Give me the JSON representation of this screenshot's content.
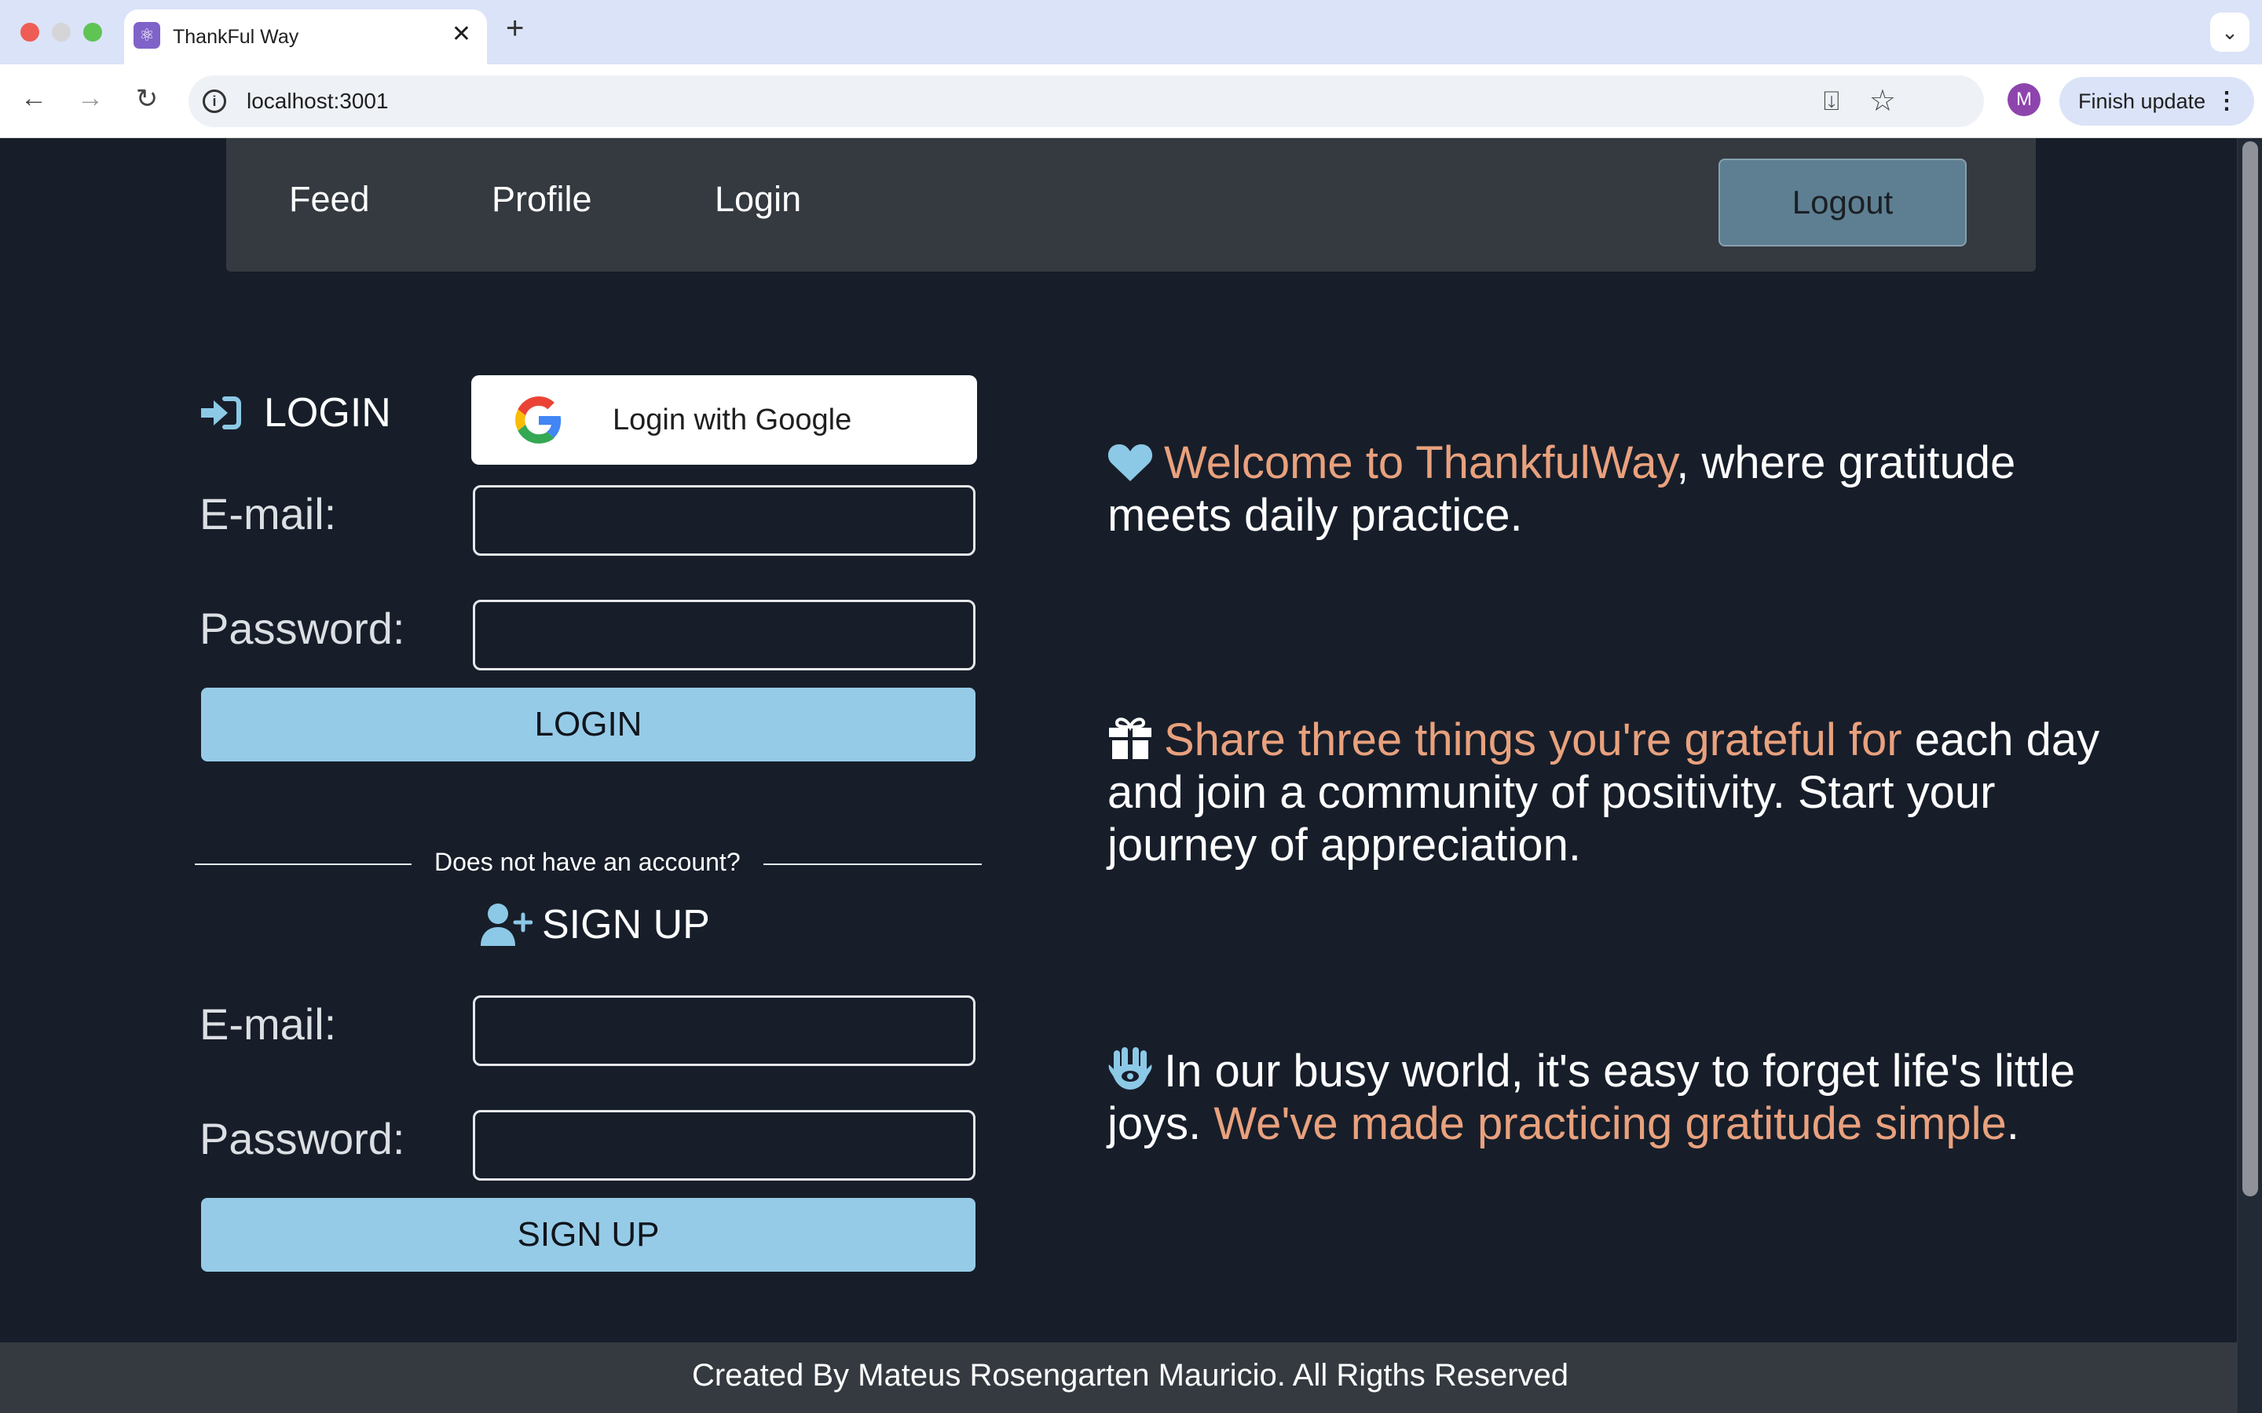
{
  "browser": {
    "tab_title": "ThankFul Way",
    "tab_close": "✕",
    "new_tab": "+",
    "tabs_menu": "⌄",
    "url": "localhost:3001",
    "avatar_letter": "M",
    "finish_update": "Finish update",
    "menu_dots": "⋮"
  },
  "navbar": {
    "feed": "Feed",
    "profile": "Profile",
    "login": "Login",
    "logout": "Logout"
  },
  "login": {
    "heading": "LOGIN",
    "google_button": "Login with Google",
    "email_label": "E-mail:",
    "email_value": "",
    "password_label": "Password:",
    "password_value": "",
    "submit": "LOGIN"
  },
  "divider_text": "Does not have an account?",
  "signup": {
    "heading": "SIGN UP",
    "email_label": "E-mail:",
    "email_value": "",
    "password_label": "Password:",
    "password_value": "",
    "submit": "SIGN UP"
  },
  "intro": {
    "p1_highlight": "Welcome to ThankfulWay",
    "p1_rest": ", where gratitude meets daily practice.",
    "p2_highlight": "Share three things you're grateful for",
    "p2_rest": " each day and join a community of positivity. Start your journey of appreciation.",
    "p3_start": "In our busy world, it's easy to forget life's little joys. ",
    "p3_highlight": "We've made practicing gratitude simple",
    "p3_end": "."
  },
  "footer": {
    "text": "Created By Mateus Rosengarten Mauricio. All Rigths Reserved"
  },
  "colors": {
    "background": "#171e2a",
    "navbar": "#343a40",
    "accent_button": "#96cbe7",
    "highlight_text": "#e9a17d",
    "icon_blue": "#8cc9e6",
    "logout_button": "#5e7f92"
  },
  "icons": {
    "login_heading": "sign-in-icon",
    "google": "google-logo-icon",
    "signup_heading": "user-plus-icon",
    "p1": "heart-icon",
    "p2": "gift-icon",
    "p3": "hamsa-icon"
  }
}
